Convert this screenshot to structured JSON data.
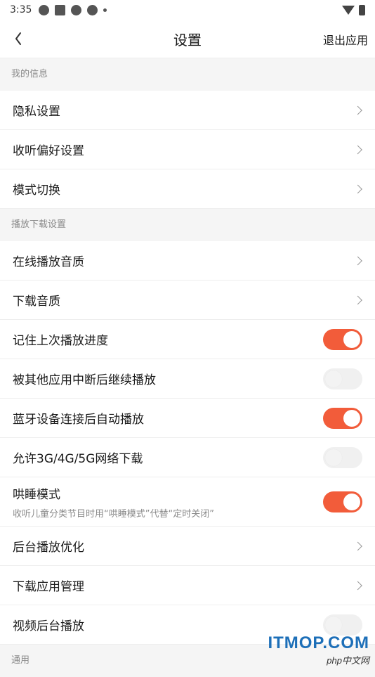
{
  "status_bar": {
    "time": "3:35",
    "icons": [
      "sync-icon",
      "square-icon",
      "sync-icon",
      "sync-icon",
      "dot-icon"
    ],
    "right_icons": [
      "wifi-icon",
      "battery-icon"
    ]
  },
  "header": {
    "title": "设置",
    "exit_label": "退出应用",
    "back_icon": "chevron-left-icon"
  },
  "sections": {
    "my_info": "我的信息",
    "playback": "播放下载设置",
    "general": "通用"
  },
  "items": {
    "privacy": "隐私设置",
    "listening_pref": "收听偏好设置",
    "mode_switch": "模式切换",
    "online_quality": "在线播放音质",
    "download_quality": "下载音质",
    "remember_progress": "记住上次播放进度",
    "resume_after_interrupt": "被其他应用中断后继续播放",
    "bluetooth_autoplay": "蓝牙设备连接后自动播放",
    "allow_mobile_download": "允许3G/4G/5G网络下载",
    "lullaby_mode": "哄睡模式",
    "lullaby_mode_desc": "收听儿童分类节目时用“哄睡模式”代替“定时关闭”",
    "background_optimize": "后台播放优化",
    "download_app_mgmt": "下载应用管理",
    "video_background": "视频后台播放"
  },
  "toggles": {
    "remember_progress": true,
    "resume_after_interrupt": false,
    "bluetooth_autoplay": true,
    "allow_mobile_download": false,
    "lullaby_mode": true,
    "video_background": false
  },
  "colors": {
    "accent": "#f25c3a",
    "background": "#f5f5f5"
  },
  "watermark": {
    "main": "ITMOP.COM",
    "sub": "php中文网"
  }
}
